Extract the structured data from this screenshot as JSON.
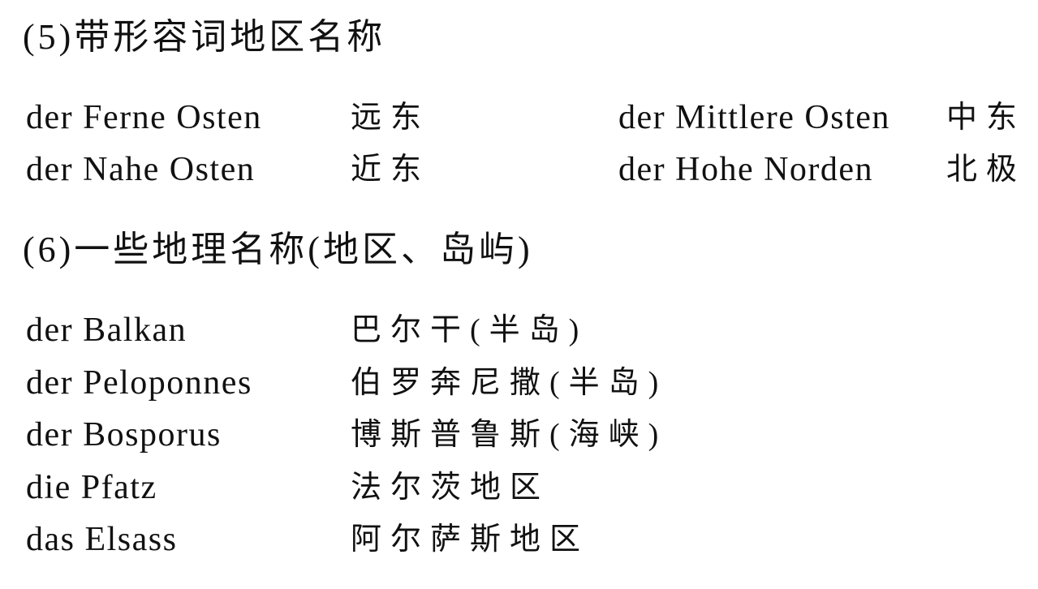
{
  "section5": {
    "heading": "(5)带形容词地区名称",
    "entries": [
      {
        "de": "der Ferne Osten",
        "zh": "远东"
      },
      {
        "de": "der Mittlere Osten",
        "zh": "中东"
      },
      {
        "de": "der Nahe Osten",
        "zh": "近东"
      },
      {
        "de": "der Hohe Norden",
        "zh": "北极"
      }
    ]
  },
  "section6": {
    "heading": "(6)一些地理名称(地区、岛屿)",
    "entries": [
      {
        "de": "der Balkan",
        "zh": "巴尔干(半岛)"
      },
      {
        "de": "der Peloponnes",
        "zh": "伯罗奔尼撒(半岛)"
      },
      {
        "de": "der Bosporus",
        "zh": "博斯普鲁斯(海峡)"
      },
      {
        "de": "die Pfatz",
        "zh": "法尔茨地区"
      },
      {
        "de": "das Elsass",
        "zh": "阿尔萨斯地区"
      }
    ]
  }
}
